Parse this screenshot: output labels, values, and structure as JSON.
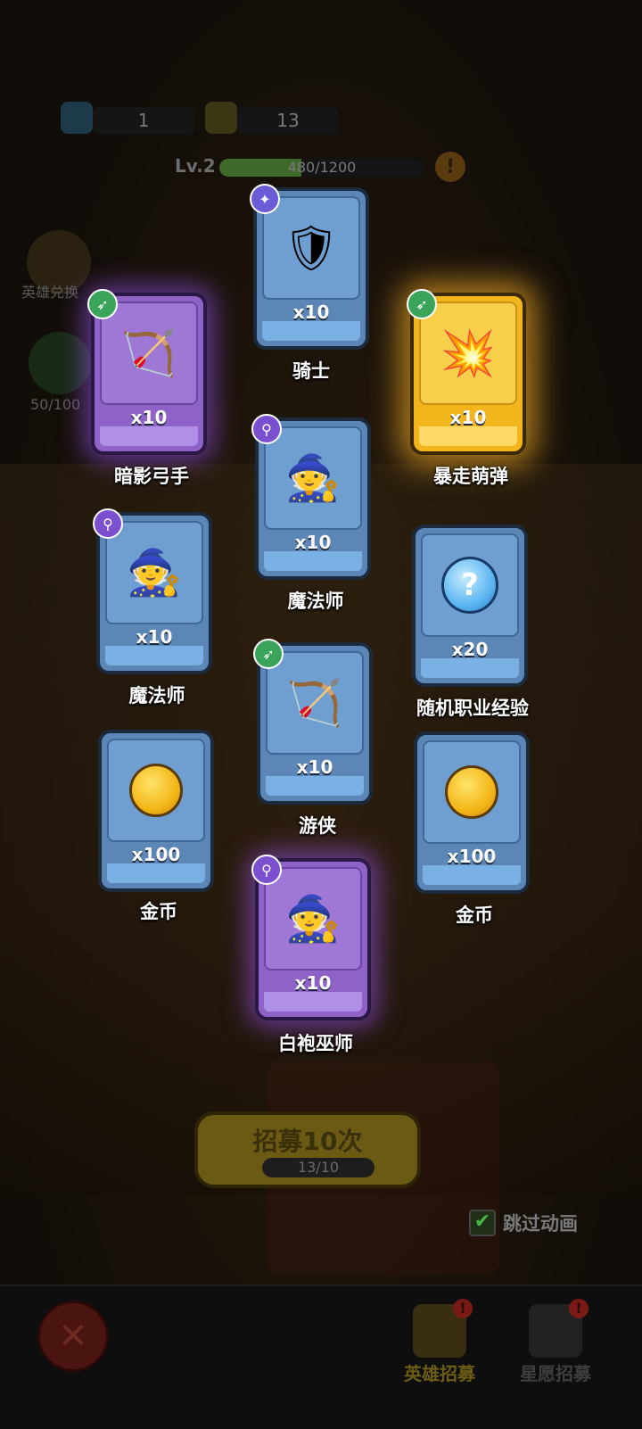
{
  "resources": {
    "gems": "1",
    "tickets": "13",
    "level": "Lv.2",
    "exp_text": "480/1200",
    "exp_progress": 0.4
  },
  "side": {
    "hero_exchange_label": "英雄兑换",
    "star_progress": "50/100"
  },
  "cards": [
    {
      "name": "骑士",
      "count": "x10",
      "rarity": "blue",
      "class_icon": "paw-icon",
      "portrait": "knight-portrait"
    },
    {
      "name": "暗影弓手",
      "count": "x10",
      "rarity": "purple",
      "class_icon": "bow-icon",
      "portrait": "shadow-archer-portrait"
    },
    {
      "name": "暴走萌弹",
      "count": "x10",
      "rarity": "gold",
      "class_icon": "bow-icon",
      "portrait": "gunner-portrait"
    },
    {
      "name": "魔法师",
      "count": "x10",
      "rarity": "blue",
      "class_icon": "wand-icon",
      "portrait": "mage-portrait"
    },
    {
      "name": "魔法师",
      "count": "x10",
      "rarity": "blue",
      "class_icon": "wand-icon",
      "portrait": "mage-portrait"
    },
    {
      "name": "随机职业经验",
      "count": "x20",
      "rarity": "blue",
      "class_icon": "",
      "portrait": "question-orb-icon"
    },
    {
      "name": "游侠",
      "count": "x10",
      "rarity": "blue",
      "class_icon": "bow-icon",
      "portrait": "ranger-portrait"
    },
    {
      "name": "金币",
      "count": "x100",
      "rarity": "blue",
      "class_icon": "",
      "portrait": "gold-coin-icon"
    },
    {
      "name": "金币",
      "count": "x100",
      "rarity": "blue",
      "class_icon": "",
      "portrait": "gold-coin-icon"
    },
    {
      "name": "白袍巫师",
      "count": "x10",
      "rarity": "purple",
      "class_icon": "wand-icon",
      "portrait": "white-wizard-portrait"
    }
  ],
  "recruit": {
    "button_label": "招募10次",
    "progress": "13/10"
  },
  "skip_animation": "跳过动画",
  "nav": {
    "hero_recruit": "英雄招募",
    "wish_recruit": "星愿招募"
  },
  "colors": {
    "blue_card": "#5b86b6",
    "purple_card": "#8e62c6",
    "gold_card": "#f2b61c"
  }
}
